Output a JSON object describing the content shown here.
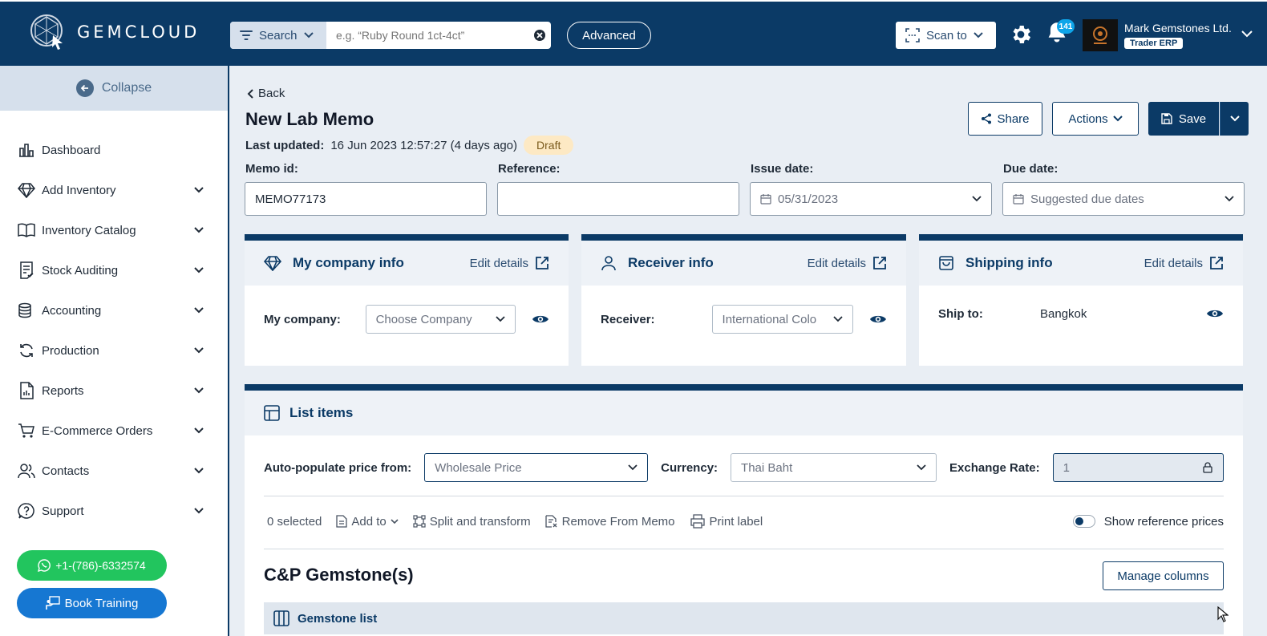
{
  "header": {
    "brand": "GEMCLOUD",
    "search_type": "Search",
    "search_placeholder": "e.g. “Ruby Round 1ct-4ct”",
    "advanced": "Advanced",
    "scan_to": "Scan to",
    "notification_count": "141",
    "company_name": "Mark Gemstones Ltd.",
    "company_tag": "Trader ERP"
  },
  "sidebar": {
    "collapse": "Collapse",
    "items": [
      {
        "label": "Dashboard",
        "icon": "chart-bar-icon",
        "expandable": false
      },
      {
        "label": "Add Inventory",
        "icon": "diamond-icon",
        "expandable": true
      },
      {
        "label": "Inventory Catalog",
        "icon": "book-icon",
        "expandable": true
      },
      {
        "label": "Stock Auditing",
        "icon": "checklist-icon",
        "expandable": true
      },
      {
        "label": "Accounting",
        "icon": "coins-icon",
        "expandable": true
      },
      {
        "label": "Production",
        "icon": "refresh-icon",
        "expandable": true
      },
      {
        "label": "Reports",
        "icon": "report-icon",
        "expandable": true
      },
      {
        "label": "E-Commerce Orders",
        "icon": "cart-icon",
        "expandable": true
      },
      {
        "label": "Contacts",
        "icon": "users-icon",
        "expandable": true
      },
      {
        "label": "Support",
        "icon": "help-icon",
        "expandable": true
      }
    ],
    "phone": "+1-(786)-6332574",
    "training": "Book Training"
  },
  "page": {
    "back": "Back",
    "title": "New Lab Memo",
    "updated_label": "Last updated:",
    "updated_value": "16 Jun 2023 12:57:27 (4 days ago)",
    "status": "Draft",
    "share": "Share",
    "actions": "Actions",
    "save": "Save"
  },
  "fields": {
    "memo_id_label": "Memo id:",
    "memo_id_value": "MEMO77173",
    "reference_label": "Reference:",
    "reference_value": "",
    "issue_date_label": "Issue date:",
    "issue_date_value": "05/31/2023",
    "due_date_label": "Due date:",
    "due_date_placeholder": "Suggested due dates"
  },
  "cards": {
    "company": {
      "title": "My company info",
      "edit": "Edit details",
      "label": "My company:",
      "value": "Choose Company"
    },
    "receiver": {
      "title": "Receiver info",
      "edit": "Edit details",
      "label": "Receiver:",
      "value": "International Colo"
    },
    "shipping": {
      "title": "Shipping info",
      "edit": "Edit details",
      "label": "Ship to:",
      "value": "Bangkok"
    }
  },
  "list": {
    "title": "List items",
    "price_from_label": "Auto-populate price from:",
    "price_from_value": "Wholesale Price",
    "currency_label": "Currency:",
    "currency_value": "Thai Baht",
    "rate_label": "Exchange Rate:",
    "rate_value": "1",
    "selected": "0 selected",
    "add_to": "Add to",
    "split": "Split and transform",
    "remove": "Remove From Memo",
    "print": "Print label",
    "show_ref": "Show reference prices",
    "section": "C&P Gemstone(s)",
    "manage": "Manage columns",
    "gem_list": "Gemstone list"
  },
  "colors": {
    "primary": "#0b3a66",
    "whatsapp": "#22c55e",
    "training": "#1677d2",
    "draft_bg": "#fde9c4"
  }
}
